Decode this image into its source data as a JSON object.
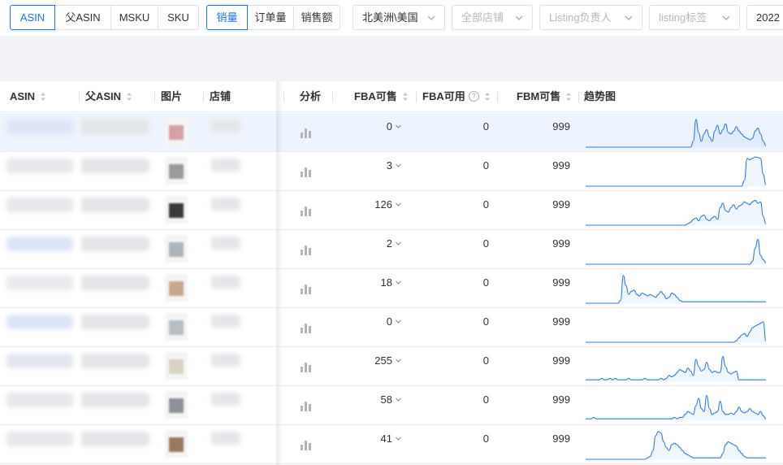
{
  "toolbar": {
    "type_tabs": [
      {
        "label": "ASIN",
        "active": true
      },
      {
        "label": "父ASIN",
        "active": false
      },
      {
        "label": "MSKU",
        "active": false
      },
      {
        "label": "SKU",
        "active": false
      }
    ],
    "metric_tabs": [
      {
        "label": "销量",
        "active": true
      },
      {
        "label": "订单量",
        "active": false
      },
      {
        "label": "销售额",
        "active": false
      }
    ],
    "region_select": "北美洲\\美国",
    "shop_select_placeholder": "全部店铺",
    "owner_select_placeholder": "Listing负责人",
    "tag_select_placeholder": "listing标签",
    "date_partial": "2022"
  },
  "table": {
    "headers": {
      "asin": "ASIN",
      "parent_asin": "父ASIN",
      "image": "图片",
      "shop": "店铺",
      "analysis": "分析",
      "fba_sellable": "FBA可售",
      "fba_available": "FBA可用",
      "fbm_sellable": "FBM可售",
      "trend": "趋势图"
    },
    "help_icon_glyph": "?",
    "rows": [
      {
        "fba_sellable": "0",
        "fba_available": "0",
        "fbm_sellable": "999",
        "thumb_color": "#d6a0a4",
        "trend": [
          0,
          0,
          0,
          0,
          0,
          0,
          0,
          0,
          0,
          0,
          0,
          0,
          0,
          0,
          0,
          0,
          0,
          0,
          0,
          0,
          0,
          0,
          0,
          0,
          0,
          0,
          0,
          0,
          0,
          0,
          0,
          0,
          0,
          0,
          0,
          0,
          0,
          0,
          0,
          0,
          0.2,
          0.95,
          0.5,
          0.2,
          0.45,
          0.6,
          0.35,
          0.2,
          0.55,
          0.75,
          0.45,
          0.6,
          0.8,
          0.5,
          0.45,
          0.55,
          0.7,
          0.55,
          0.45,
          0.35,
          0.3,
          0.25,
          0.3,
          0.55,
          0.65,
          0.45,
          0.2,
          0.05
        ]
      },
      {
        "fba_sellable": "3",
        "fba_available": "0",
        "fbm_sellable": "999",
        "thumb_color": "#9a9a9a",
        "trend": [
          0,
          0,
          0,
          0,
          0,
          0,
          0,
          0,
          0,
          0,
          0,
          0,
          0,
          0,
          0,
          0,
          0,
          0,
          0,
          0,
          0,
          0,
          0,
          0,
          0,
          0,
          0,
          0,
          0,
          0,
          0,
          0,
          0,
          0,
          0,
          0,
          0,
          0,
          0,
          0,
          0,
          0,
          0,
          0,
          0,
          0,
          0,
          0,
          0,
          0,
          0,
          0,
          0,
          0,
          0,
          0,
          0,
          0,
          0,
          0.2,
          0.95,
          0.9,
          0.95,
          1,
          0.98,
          0.95,
          0.4,
          0.05
        ]
      },
      {
        "fba_sellable": "126",
        "fba_available": "0",
        "fbm_sellable": "999",
        "thumb_color": "#3a3a3a",
        "trend": [
          0,
          0,
          0,
          0,
          0,
          0,
          0,
          0,
          0,
          0,
          0,
          0,
          0,
          0,
          0,
          0,
          0,
          0,
          0,
          0,
          0,
          0,
          0,
          0,
          0,
          0,
          0,
          0,
          0,
          0,
          0,
          0,
          0,
          0,
          0,
          0,
          0,
          0,
          0.05,
          0.1,
          0.2,
          0.25,
          0.15,
          0.3,
          0.35,
          0.2,
          0.15,
          0.25,
          0.3,
          0.2,
          0.6,
          0.75,
          0.5,
          0.45,
          0.6,
          0.7,
          0.55,
          0.65,
          0.7,
          0.8,
          0.75,
          0.7,
          0.8,
          0.85,
          0.75,
          0.8,
          0.3,
          0.05
        ]
      },
      {
        "fba_sellable": "2",
        "fba_available": "0",
        "fbm_sellable": "999",
        "thumb_color": "#aeb4bc",
        "trend": [
          0,
          0,
          0,
          0,
          0,
          0,
          0,
          0,
          0,
          0,
          0,
          0,
          0,
          0,
          0,
          0,
          0,
          0,
          0,
          0,
          0,
          0,
          0,
          0,
          0,
          0,
          0,
          0,
          0,
          0,
          0,
          0,
          0,
          0,
          0,
          0,
          0,
          0,
          0,
          0,
          0,
          0,
          0,
          0,
          0,
          0,
          0,
          0,
          0,
          0,
          0,
          0,
          0,
          0,
          0,
          0,
          0,
          0,
          0,
          0,
          0,
          0,
          0.1,
          0.55,
          0.85,
          0.3,
          0.15,
          0.05
        ]
      },
      {
        "fba_sellable": "18",
        "fba_available": "0",
        "fbm_sellable": "999",
        "thumb_color": "#c9a68c",
        "trend": [
          0,
          0,
          0,
          0,
          0,
          0,
          0,
          0,
          0,
          0,
          0,
          0,
          0,
          0.1,
          0.95,
          0.6,
          0.3,
          0.4,
          0.45,
          0.3,
          0.25,
          0.35,
          0.3,
          0.25,
          0.3,
          0.25,
          0.2,
          0.3,
          0.4,
          0.3,
          0.15,
          0.2,
          0.35,
          0.3,
          0.2,
          0.1,
          0.05,
          0.05,
          0.05,
          0.05,
          0.05,
          0.05,
          0.05,
          0.05,
          0.05,
          0.05,
          0.05,
          0.05,
          0.05,
          0.05,
          0.05,
          0.05,
          0.05,
          0.05,
          0.05,
          0.05,
          0.05,
          0.05,
          0.05,
          0.05,
          0.05,
          0.05,
          0.05,
          0.05,
          0.05,
          0.05,
          0.05,
          0.05
        ]
      },
      {
        "fba_sellable": "0",
        "fba_available": "0",
        "fbm_sellable": "999",
        "thumb_color": "#b6bdc2",
        "trend": [
          0,
          0,
          0,
          0,
          0,
          0,
          0,
          0,
          0,
          0,
          0,
          0,
          0,
          0,
          0,
          0,
          0,
          0,
          0,
          0,
          0,
          0,
          0,
          0,
          0,
          0,
          0,
          0,
          0,
          0,
          0,
          0,
          0,
          0,
          0,
          0,
          0,
          0,
          0,
          0,
          0,
          0,
          0,
          0,
          0,
          0,
          0,
          0,
          0,
          0,
          0,
          0,
          0,
          0,
          0,
          0,
          0.05,
          0.15,
          0.25,
          0.3,
          0.2,
          0.35,
          0.5,
          0.55,
          0.6,
          0.65,
          0.7,
          0.05
        ]
      },
      {
        "fba_sellable": "255",
        "fba_available": "0",
        "fbm_sellable": "999",
        "thumb_color": "#d9d3c2",
        "trend": [
          0.05,
          0.05,
          0.05,
          0.05,
          0.05,
          0.05,
          0.1,
          0.05,
          0.05,
          0.1,
          0.05,
          0.1,
          0.05,
          0.05,
          0.05,
          0.05,
          0.1,
          0.05,
          0.05,
          0.05,
          0.05,
          0.05,
          0.1,
          0.05,
          0.05,
          0.05,
          0.05,
          0.05,
          0.1,
          0.05,
          0.1,
          0.2,
          0.15,
          0.2,
          0.3,
          0.4,
          0.35,
          0.3,
          0.45,
          0.35,
          0.2,
          0.75,
          0.5,
          0.35,
          0.4,
          0.65,
          0.4,
          0.3,
          0.35,
          0.3,
          0.3,
          0.85,
          0.5,
          0.3,
          0.25,
          0.3,
          0.35,
          0.05,
          0.05,
          0.05,
          0.05,
          0.05,
          0.05,
          0.05,
          0.05,
          0.05,
          0.05,
          0.05
        ]
      },
      {
        "fba_sellable": "58",
        "fba_available": "0",
        "fbm_sellable": "999",
        "thumb_color": "#8f9199",
        "trend": [
          0.05,
          0.05,
          0.05,
          0.1,
          0.05,
          0.05,
          0.05,
          0.05,
          0.05,
          0.05,
          0.05,
          0.05,
          0.05,
          0.05,
          0.05,
          0.05,
          0.05,
          0.05,
          0.05,
          0.05,
          0.05,
          0.05,
          0.05,
          0.05,
          0.05,
          0.05,
          0.05,
          0.05,
          0.05,
          0.05,
          0.05,
          0.05,
          0.05,
          0.1,
          0.05,
          0.1,
          0.1,
          0.2,
          0.3,
          0.25,
          0.2,
          0.5,
          0.75,
          0.4,
          0.3,
          0.85,
          0.4,
          0.2,
          0.25,
          0.3,
          0.65,
          0.3,
          0.2,
          0.2,
          0.25,
          0.2,
          0.3,
          0.45,
          0.3,
          0.25,
          0.3,
          0.4,
          0.3,
          0.25,
          0.2,
          0.3,
          0.15,
          0.05
        ]
      },
      {
        "fba_sellable": "41",
        "fba_available": "0",
        "fbm_sellable": "999",
        "thumb_color": "#9c7760",
        "trend": [
          0,
          0,
          0,
          0,
          0,
          0,
          0,
          0,
          0,
          0,
          0,
          0,
          0,
          0,
          0,
          0,
          0,
          0,
          0,
          0,
          0,
          0,
          0,
          0.05,
          0.1,
          0.3,
          0.8,
          0.95,
          0.9,
          0.6,
          0.4,
          0.3,
          0.5,
          0.55,
          0.5,
          0.4,
          0.3,
          0.2,
          0.15,
          0.1,
          0.05,
          0.05,
          0.05,
          0.05,
          0.05,
          0.05,
          0.05,
          0.05,
          0.05,
          0.05,
          0.05,
          0.2,
          0.5,
          0.6,
          0.55,
          0.5,
          0.45,
          0.3,
          0.2,
          0.1,
          0.05,
          0.05,
          0.05,
          0.05,
          0.05,
          0.05,
          0.05,
          0.05
        ]
      }
    ]
  },
  "colors": {
    "accent": "#1a73e8",
    "trend_line": "#2f7ae5",
    "highlight_row": "#eef4fd"
  }
}
